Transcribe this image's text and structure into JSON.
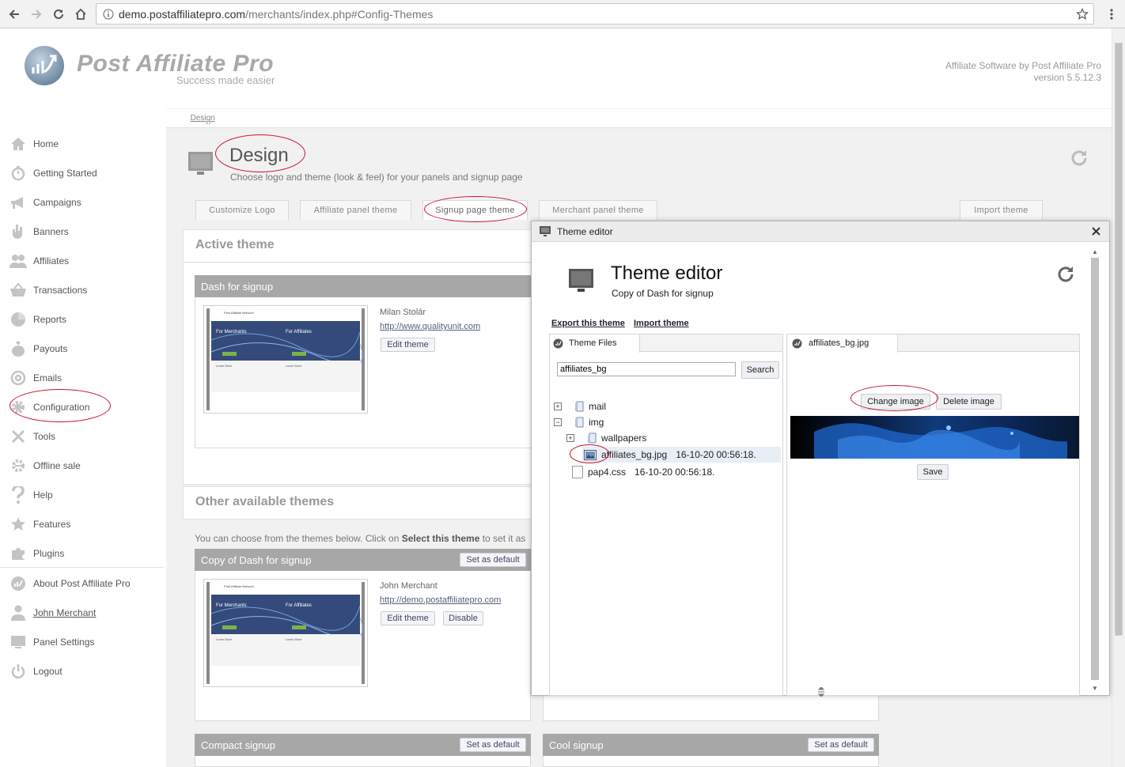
{
  "browser": {
    "url_host": "demo.postaffiliatepro.com",
    "url_path": "/merchants/index.php#Config-Themes"
  },
  "header": {
    "logo_title": "Post Affiliate Pro",
    "tagline": "Success made easier",
    "vendor_line1": "Affiliate Software by Post Affiliate Pro",
    "vendor_line2": "version 5.5.12.3"
  },
  "sidebar": {
    "items": [
      {
        "label": "Home",
        "icon": "home-icon"
      },
      {
        "label": "Getting Started",
        "icon": "stopwatch-icon"
      },
      {
        "label": "Campaigns",
        "icon": "megaphone-icon"
      },
      {
        "label": "Banners",
        "icon": "banner-hand-icon"
      },
      {
        "label": "Affiliates",
        "icon": "users-icon"
      },
      {
        "label": "Transactions",
        "icon": "basket-icon"
      },
      {
        "label": "Reports",
        "icon": "pie-chart-icon"
      },
      {
        "label": "Payouts",
        "icon": "money-bag-icon"
      },
      {
        "label": "Emails",
        "icon": "at-sign-icon"
      },
      {
        "label": "Configuration",
        "icon": "gear-icon"
      },
      {
        "label": "Tools",
        "icon": "tools-icon"
      },
      {
        "label": "Offline sale",
        "icon": "offline-sale-icon"
      },
      {
        "label": "Help",
        "icon": "question-icon"
      },
      {
        "label": "Features",
        "icon": "star-icon"
      },
      {
        "label": "Plugins",
        "icon": "puzzle-icon"
      }
    ],
    "bottom_items": [
      {
        "label": "About Post Affiliate Pro",
        "icon": "pap-logo-icon"
      },
      {
        "label": "John Merchant",
        "icon": "user-icon"
      },
      {
        "label": "Panel Settings",
        "icon": "panel-settings-icon"
      },
      {
        "label": "Logout",
        "icon": "power-icon"
      }
    ]
  },
  "breadcrumb": {
    "prefix": "››",
    "current": "Design"
  },
  "page": {
    "title": "Design",
    "description": "Choose logo and theme (look & feel) for your panels and signup page"
  },
  "tabs": [
    "Customize Logo",
    "Affiliate panel theme",
    "Signup page theme",
    "Merchant panel theme",
    "Import theme"
  ],
  "active_theme": {
    "section_title": "Active theme",
    "name": "Dash for signup",
    "author": "Milan Stolár",
    "url": "http://www.qualityunit.com",
    "edit_label": "Edit theme"
  },
  "other_themes": {
    "section_title": "Other available themes",
    "intro_prefix": "You can choose from the themes below. Click on ",
    "intro_bold": "Select this theme",
    "intro_suffix": " to set it as",
    "items": [
      {
        "name": "Copy of Dash for signup",
        "set_default": "Set as default",
        "author": "John Merchant",
        "url": "http://demo.postaffiliatepro.com",
        "edit_label": "Edit theme",
        "disable_label": "Disable"
      },
      {
        "name": "Compact signup",
        "set_default": "Set as default"
      },
      {
        "name": "Cool signup",
        "set_default": "Set as default"
      }
    ]
  },
  "thumbnail": {
    "brand": "Post Affiliate Network",
    "panel_left": "For Merchants",
    "panel_right": "For Affiliates",
    "learn_more": "Learn More"
  },
  "dialog": {
    "title": "Theme editor",
    "heading": "Theme editor",
    "subheading": "Copy of Dash for signup",
    "export_link": "Export this theme",
    "import_link": "Import theme",
    "files_tab": "Theme Files",
    "search_value": "affiliates_bg",
    "search_button": "Search",
    "tree": [
      {
        "label": "mail",
        "toggle": "+",
        "type": "folder"
      },
      {
        "label": "img",
        "toggle": "−",
        "type": "folder"
      },
      {
        "label": "wallpapers",
        "toggle": "+",
        "type": "folder"
      },
      {
        "label": "affiliates_bg.jpg",
        "date": "16-10-20 00:56:18.",
        "type": "image"
      },
      {
        "label": "pap4.css",
        "date": "16-10-20 00:56:18.",
        "type": "file"
      }
    ],
    "file_tab": "affiliates_bg.jpg",
    "change_image": "Change image",
    "delete_image": "Delete image",
    "save": "Save"
  },
  "colors": {
    "annotation_red": "#c8102e",
    "theme_header_gray": "#a7a7a7",
    "link_blue": "#55607a"
  }
}
